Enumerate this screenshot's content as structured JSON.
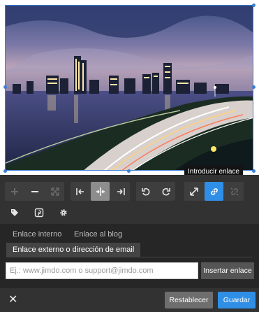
{
  "image": {
    "description_icon": "photo-boston-night-skyline"
  },
  "tooltip": {
    "text": "Introducir enlace"
  },
  "toolbar": {
    "row1": [
      {
        "name": "zoom-in-icon",
        "state": "disabled"
      },
      {
        "name": "zoom-out-icon",
        "state": "normal"
      },
      {
        "name": "fit-icon",
        "state": "disabled"
      },
      {
        "name": "align-left-icon",
        "state": "normal"
      },
      {
        "name": "align-center-icon",
        "state": "active"
      },
      {
        "name": "align-right-icon",
        "state": "normal"
      },
      {
        "name": "rotate-left-icon",
        "state": "normal"
      },
      {
        "name": "rotate-right-icon",
        "state": "normal"
      },
      {
        "name": "fullscreen-icon",
        "state": "normal"
      },
      {
        "name": "link-icon",
        "state": "active"
      },
      {
        "name": "unlink-icon",
        "state": "disabled"
      }
    ],
    "row2": [
      {
        "name": "tag-icon"
      },
      {
        "name": "pinterest-icon"
      },
      {
        "name": "gear-icon"
      }
    ]
  },
  "link_panel": {
    "tab_internal": "Enlace interno",
    "tab_blog": "Enlace al blog",
    "tab_external": "Enlace externo o dirección de email",
    "input_placeholder": "Ej.: www.jimdo.com o support@jimdo.com",
    "input_value": "",
    "insert_label": "Insertar enlace"
  },
  "footer": {
    "close_symbol": "✕",
    "reset_label": "Restablecer",
    "save_label": "Guardar"
  },
  "colors": {
    "accent": "#2f8fe6",
    "panel": "#323232",
    "panel_dark": "#262626"
  }
}
